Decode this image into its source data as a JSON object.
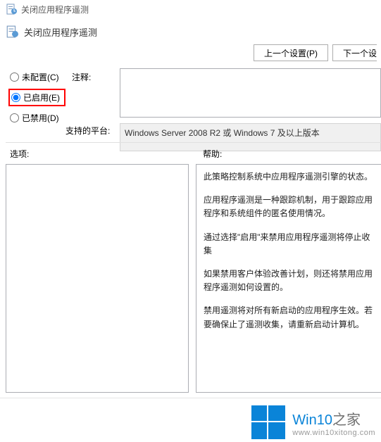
{
  "window": {
    "title": "关闭应用程序遥测"
  },
  "policy": {
    "name": "关闭应用程序遥测"
  },
  "nav": {
    "prev": "上一个设置(P)",
    "next": "下一个设"
  },
  "radios": {
    "not_configured": "未配置(C)",
    "enabled": "已启用(E)",
    "disabled": "已禁用(D)",
    "selected": "enabled"
  },
  "labels": {
    "comment": "注释:",
    "supported": "支持的平台:",
    "options": "选项:",
    "help": "帮助:"
  },
  "supported_text": "Windows Server 2008 R2 或 Windows 7 及以上版本",
  "help_paragraphs": [
    "此策略控制系统中应用程序遥测引擎的状态。",
    "应用程序遥测是一种跟踪机制，用于跟踪应用程序和系统组件的匿名使用情况。",
    "通过选择\"启用\"来禁用应用程序遥测将停止收集",
    "如果禁用客户体验改善计划，则还将禁用应用程序遥测如何设置的。",
    "禁用遥测将对所有新启动的应用程序生效。若要确保止了遥测收集，请重新启动计算机。"
  ],
  "watermark": {
    "brand_left": "Win10",
    "brand_right": "之家",
    "url": "www.win10xitong.com"
  }
}
